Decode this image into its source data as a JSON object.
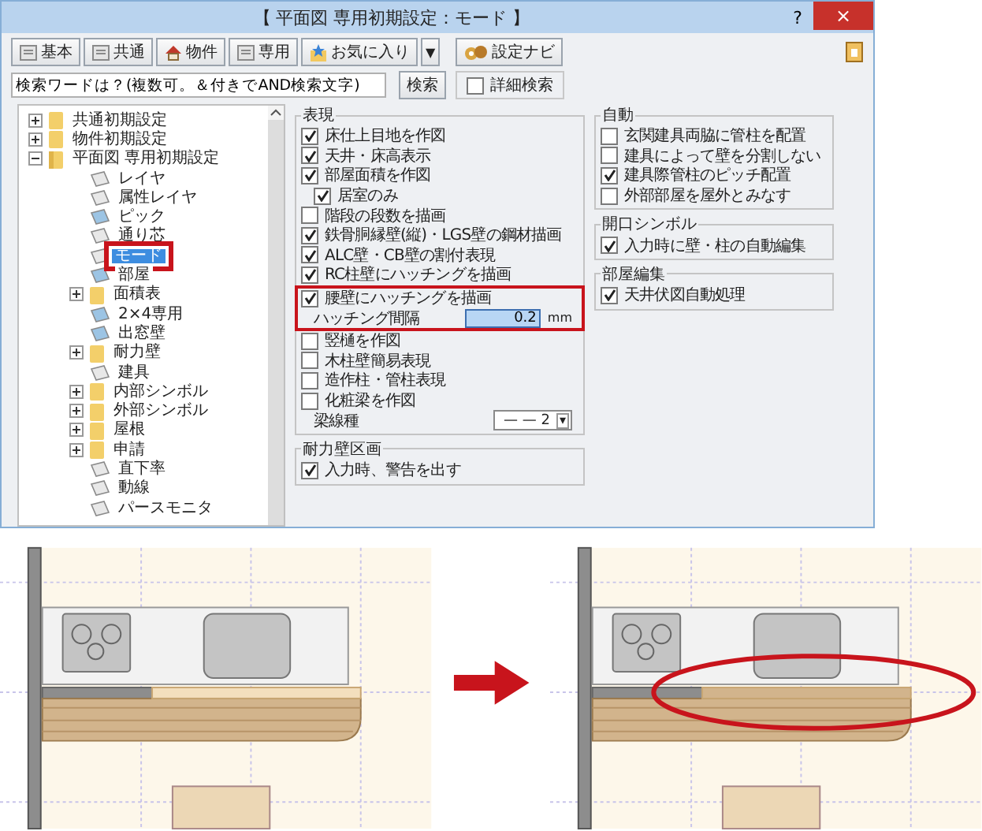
{
  "window": {
    "title": "【 平面図 専用初期設定：モード 】",
    "help": "?",
    "close": "×"
  },
  "toolbar": {
    "buttons": [
      {
        "label": "基本",
        "kind": "doc"
      },
      {
        "label": "共通",
        "kind": "doc"
      },
      {
        "label": "物件",
        "kind": "house"
      },
      {
        "label": "専用",
        "kind": "doc"
      },
      {
        "label": "お気に入り",
        "kind": "star"
      }
    ],
    "dropdown": "▼",
    "navi": "設定ナビ"
  },
  "search": {
    "value": "検索ワードは？(複数可。＆付きでAND検索文字)",
    "button": "検索",
    "detail": {
      "label": "詳細検索",
      "checked": false
    }
  },
  "tree": [
    {
      "label": "共通初期設定",
      "kind": "folder",
      "expanded": false,
      "selected": false
    },
    {
      "label": "物件初期設定",
      "kind": "folder",
      "expanded": false,
      "selected": false
    },
    {
      "label": "平面図 専用初期設定",
      "kind": "folder",
      "expanded": true,
      "selected": false,
      "children": [
        {
          "label": "レイヤ",
          "kind": "page",
          "selected": false
        },
        {
          "label": "属性レイヤ",
          "kind": "page",
          "selected": false
        },
        {
          "label": "ピック",
          "kind": "custom",
          "selected": false
        },
        {
          "label": "通り芯",
          "kind": "page",
          "selected": false
        },
        {
          "label": "モード",
          "kind": "page",
          "selected": true,
          "highlighted": true
        },
        {
          "label": "部屋",
          "kind": "custom",
          "selected": false
        },
        {
          "label": "面積表",
          "kind": "folder",
          "expanded": false,
          "selected": false
        },
        {
          "label": "2×4専用",
          "kind": "custom",
          "selected": false
        },
        {
          "label": "出窓壁",
          "kind": "custom",
          "selected": false
        },
        {
          "label": "耐力壁",
          "kind": "folder",
          "expanded": false,
          "selected": false
        },
        {
          "label": "建具",
          "kind": "page",
          "selected": false
        },
        {
          "label": "内部シンボル",
          "kind": "folder",
          "expanded": false,
          "selected": false
        },
        {
          "label": "外部シンボル",
          "kind": "folder",
          "expanded": false,
          "selected": false
        },
        {
          "label": "屋根",
          "kind": "folder",
          "expanded": false,
          "selected": false
        },
        {
          "label": "申請",
          "kind": "folder",
          "expanded": false,
          "selected": false
        },
        {
          "label": "直下率",
          "kind": "page",
          "selected": false
        },
        {
          "label": "動線",
          "kind": "page",
          "selected": false
        },
        {
          "label": "パースモニタ",
          "kind": "page",
          "selected": false
        }
      ]
    }
  ],
  "columns": [
    [
      {
        "title": "表現",
        "items": [
          {
            "kind": "check",
            "label": "床仕上目地を作図",
            "checked": true
          },
          {
            "kind": "check",
            "label": "天井・床高表示",
            "checked": true
          },
          {
            "kind": "check",
            "label": "部屋面積を作図",
            "checked": true,
            "children": [
              {
                "kind": "check",
                "label": "居室のみ",
                "checked": true
              }
            ]
          },
          {
            "kind": "check",
            "label": "階段の段数を描画",
            "checked": false
          },
          {
            "kind": "check",
            "label": "鉄骨胴縁壁(縦)・LGS壁の鋼材描画",
            "checked": true
          },
          {
            "kind": "check",
            "label": "ALC壁・CB壁の割付表現",
            "checked": true
          },
          {
            "kind": "check",
            "label": "RC柱壁にハッチングを描画",
            "checked": true
          },
          {
            "kind": "check",
            "label": "腰壁にハッチングを描画",
            "checked": true,
            "highlighted": true,
            "children": [
              {
                "kind": "number",
                "label": "ハッチング間隔",
                "value": "0.2",
                "unit": "mm"
              }
            ]
          },
          {
            "kind": "check",
            "label": "竪樋を作図",
            "checked": false
          },
          {
            "kind": "check",
            "label": "木柱壁簡易表現",
            "checked": false
          },
          {
            "kind": "check",
            "label": "造作柱・管柱表現",
            "checked": false
          },
          {
            "kind": "check",
            "label": "化粧梁を作図",
            "checked": false,
            "children": [
              {
                "kind": "select",
                "label": "梁線種",
                "value": "— — 2",
                "caret": "▾"
              }
            ]
          }
        ]
      },
      {
        "title": "耐力壁区画",
        "items": [
          {
            "kind": "check",
            "label": "入力時、警告を出す",
            "checked": true
          }
        ]
      }
    ],
    [
      {
        "title": "自動",
        "items": [
          {
            "kind": "check",
            "label": "玄関建具両脇に管柱を配置",
            "checked": false
          },
          {
            "kind": "check",
            "label": "建具によって壁を分割しない",
            "checked": false
          },
          {
            "kind": "check",
            "label": "建具際管柱のピッチ配置",
            "checked": true
          },
          {
            "kind": "check",
            "label": "外部部屋を屋外とみなす",
            "checked": false
          }
        ]
      },
      {
        "title": "開口シンボル",
        "items": [
          {
            "kind": "check",
            "label": "入力時に壁・柱の自動編集",
            "checked": true
          }
        ]
      },
      {
        "title": "部屋編集",
        "items": [
          {
            "kind": "check",
            "label": "天井伏図自動処理",
            "checked": true
          }
        ]
      }
    ]
  ],
  "illustration": {
    "panels": [
      {
        "highlighted": false
      },
      {
        "highlighted": true
      }
    ]
  }
}
